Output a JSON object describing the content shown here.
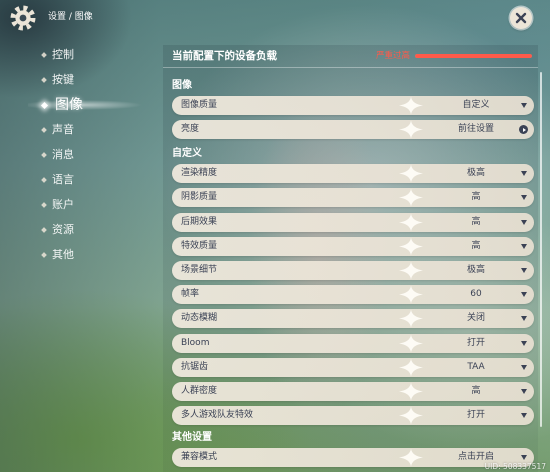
{
  "topbar": {
    "breadcrumb": "设置 / 图像"
  },
  "sidebar": {
    "selected_index": 2,
    "items": [
      {
        "label": "控制"
      },
      {
        "label": "按键"
      },
      {
        "label": "图像"
      },
      {
        "label": "声音"
      },
      {
        "label": "消息"
      },
      {
        "label": "语言"
      },
      {
        "label": "账户"
      },
      {
        "label": "资源"
      },
      {
        "label": "其他"
      }
    ]
  },
  "main": {
    "load": {
      "title": "当前配置下的设备负载",
      "status": "严重过高",
      "level": 1.0
    },
    "sections": [
      {
        "title": "图像",
        "rows": [
          {
            "label": "图像质量",
            "value": "自定义",
            "icon": "chevron-down-icon"
          },
          {
            "label": "亮度",
            "value": "前往设置",
            "icon": "arrow-right-circle-icon"
          }
        ]
      },
      {
        "title": "自定义",
        "rows": [
          {
            "label": "渲染精度",
            "value": "极高",
            "icon": "chevron-down-icon"
          },
          {
            "label": "阴影质量",
            "value": "高",
            "icon": "chevron-down-icon"
          },
          {
            "label": "后期效果",
            "value": "高",
            "icon": "chevron-down-icon"
          },
          {
            "label": "特效质量",
            "value": "高",
            "icon": "chevron-down-icon"
          },
          {
            "label": "场景细节",
            "value": "极高",
            "icon": "chevron-down-icon"
          },
          {
            "label": "帧率",
            "value": "60",
            "icon": "chevron-down-icon"
          },
          {
            "label": "动态模糊",
            "value": "关闭",
            "icon": "chevron-down-icon"
          },
          {
            "label": "Bloom",
            "value": "打开",
            "icon": "chevron-down-icon"
          },
          {
            "label": "抗锯齿",
            "value": "TAA",
            "icon": "chevron-down-icon"
          },
          {
            "label": "人群密度",
            "value": "高",
            "icon": "chevron-down-icon"
          },
          {
            "label": "多人游戏队友特效",
            "value": "打开",
            "icon": "chevron-down-icon"
          }
        ]
      },
      {
        "title": "其他设置",
        "rows": [
          {
            "label": "兼容模式",
            "value": "点击开启",
            "icon": "chevron-down-icon"
          }
        ]
      }
    ]
  },
  "footer": {
    "uid": "UID: 508337517"
  },
  "icons": {
    "settings": "gear-icon",
    "close": "close-icon",
    "bullet": "diamond-icon",
    "decoration": "sparkle-icon"
  },
  "colors": {
    "load_critical": "#ff5a4a",
    "row_background": "#ece5d8",
    "row_text": "#3b4255",
    "ui_light": "#ece5d8"
  }
}
